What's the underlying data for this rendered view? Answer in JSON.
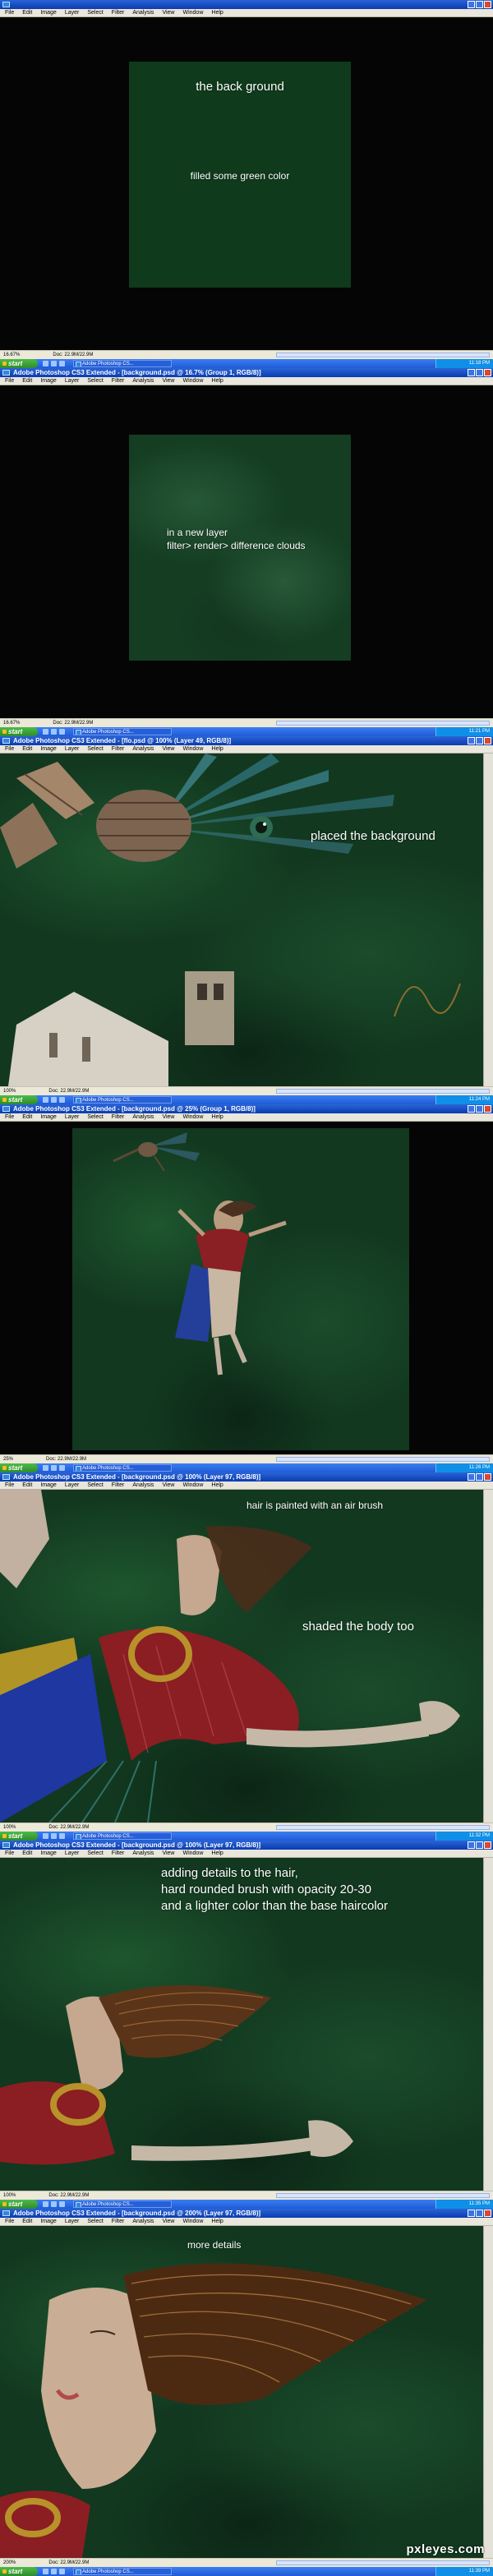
{
  "menu": [
    "File",
    "Edit",
    "Image",
    "Layer",
    "Select",
    "Filter",
    "Analysis",
    "View",
    "Window",
    "Help"
  ],
  "taskbar": {
    "start": "start"
  },
  "watermark": "pxleyes.com",
  "panels": [
    {
      "title": "",
      "status_zoom": "16.67%",
      "status_doc": "Doc: 22.9M/22.9M",
      "task": "Adobe Photoshop CS...",
      "clock": "11:18 PM",
      "captions": [
        "the back ground",
        "filled some green color"
      ]
    },
    {
      "title": "Adobe Photoshop CS3 Extended - [background.psd @ 16.7% (Group 1, RGB/8)]",
      "status_zoom": "16.67%",
      "status_doc": "Doc: 22.9M/22.9M",
      "task": "Adobe Photoshop CS...",
      "clock": "11:21 PM",
      "captions": [
        "in a new layer",
        "filter> render> difference clouds"
      ]
    },
    {
      "title": "Adobe Photoshop CS3 Extended - [flo.psd @ 100% (Layer 49, RGB/8)]",
      "status_zoom": "100%",
      "status_doc": "Doc: 22.9M/22.9M",
      "task": "Adobe Photoshop CS...",
      "clock": "11:24 PM",
      "captions": [
        "placed the background"
      ]
    },
    {
      "title": "Adobe Photoshop CS3 Extended - [background.psd @ 25% (Group 1, RGB/8)]",
      "status_zoom": "25%",
      "status_doc": "Doc: 22.9M/22.9M",
      "task": "Adobe Photoshop CS...",
      "clock": "11:26 PM",
      "captions": []
    },
    {
      "title": "Adobe Photoshop CS3 Extended - [background.psd @ 100% (Layer 97, RGB/8)]",
      "status_zoom": "100%",
      "status_doc": "Doc: 22.9M/22.9M",
      "task": "Adobe Photoshop CS...",
      "clock": "11:32 PM",
      "captions": [
        "hair is painted with an air brush",
        "shaded the body too"
      ]
    },
    {
      "title": "Adobe Photoshop CS3 Extended - [background.psd @ 100% (Layer 97, RGB/8)]",
      "status_zoom": "100%",
      "status_doc": "Doc: 22.9M/22.9M",
      "task": "Adobe Photoshop CS...",
      "clock": "11:35 PM",
      "captions": [
        "adding details to the hair,",
        "hard rounded brush with opacity 20-30",
        "and a lighter color than the base haircolor"
      ]
    },
    {
      "title": "Adobe Photoshop CS3 Extended - [background.psd @ 200% (Layer 97, RGB/8)]",
      "status_zoom": "200%",
      "status_doc": "Doc: 22.9M/22.9M",
      "task": "Adobe Photoshop CS...",
      "clock": "11:39 PM",
      "captions": [
        "more details"
      ]
    }
  ]
}
